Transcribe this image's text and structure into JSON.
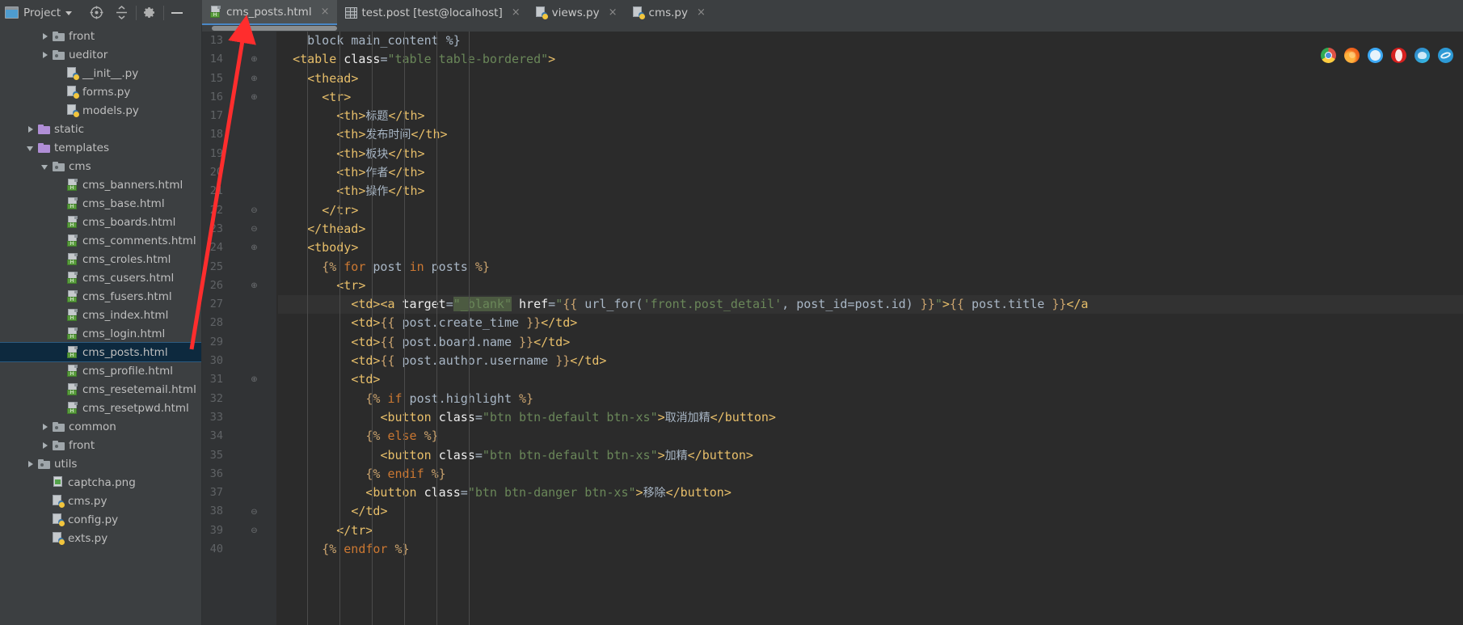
{
  "window": {
    "project_label": "Project",
    "toolbar_icons": [
      "target-icon",
      "collapse-all-icon",
      "settings-gear-icon",
      "minimize-icon"
    ]
  },
  "tabs": [
    {
      "label": "cms_posts.html",
      "icon": "html-file-icon",
      "active": true,
      "close": "×"
    },
    {
      "label": "test.post [test@localhost]",
      "icon": "database-table-icon",
      "active": false,
      "close": "×"
    },
    {
      "label": "views.py",
      "icon": "python-file-icon",
      "active": false,
      "close": "×"
    },
    {
      "label": "cms.py",
      "icon": "python-file-icon",
      "active": false,
      "close": "×"
    }
  ],
  "tree": [
    {
      "label": "front",
      "indent": 2,
      "arrow": "right",
      "icon": "folder-grey",
      "selected": false
    },
    {
      "label": "ueditor",
      "indent": 2,
      "arrow": "right",
      "icon": "folder-grey",
      "selected": false
    },
    {
      "label": "__init__.py",
      "indent": 3,
      "arrow": "none",
      "icon": "python-file",
      "selected": false
    },
    {
      "label": "forms.py",
      "indent": 3,
      "arrow": "none",
      "icon": "python-file",
      "selected": false
    },
    {
      "label": "models.py",
      "indent": 3,
      "arrow": "none",
      "icon": "python-file",
      "selected": false
    },
    {
      "label": "static",
      "indent": 1,
      "arrow": "right",
      "icon": "folder-purple",
      "selected": false
    },
    {
      "label": "templates",
      "indent": 1,
      "arrow": "down",
      "icon": "folder-purple",
      "selected": false
    },
    {
      "label": "cms",
      "indent": 2,
      "arrow": "down",
      "icon": "folder-grey",
      "selected": false
    },
    {
      "label": "cms_banners.html",
      "indent": 3,
      "arrow": "none",
      "icon": "html-file",
      "selected": false
    },
    {
      "label": "cms_base.html",
      "indent": 3,
      "arrow": "none",
      "icon": "html-file",
      "selected": false
    },
    {
      "label": "cms_boards.html",
      "indent": 3,
      "arrow": "none",
      "icon": "html-file",
      "selected": false
    },
    {
      "label": "cms_comments.html",
      "indent": 3,
      "arrow": "none",
      "icon": "html-file",
      "selected": false
    },
    {
      "label": "cms_croles.html",
      "indent": 3,
      "arrow": "none",
      "icon": "html-file",
      "selected": false
    },
    {
      "label": "cms_cusers.html",
      "indent": 3,
      "arrow": "none",
      "icon": "html-file",
      "selected": false
    },
    {
      "label": "cms_fusers.html",
      "indent": 3,
      "arrow": "none",
      "icon": "html-file",
      "selected": false
    },
    {
      "label": "cms_index.html",
      "indent": 3,
      "arrow": "none",
      "icon": "html-file",
      "selected": false
    },
    {
      "label": "cms_login.html",
      "indent": 3,
      "arrow": "none",
      "icon": "html-file",
      "selected": false
    },
    {
      "label": "cms_posts.html",
      "indent": 3,
      "arrow": "none",
      "icon": "html-file",
      "selected": true
    },
    {
      "label": "cms_profile.html",
      "indent": 3,
      "arrow": "none",
      "icon": "html-file",
      "selected": false
    },
    {
      "label": "cms_resetemail.html",
      "indent": 3,
      "arrow": "none",
      "icon": "html-file",
      "selected": false
    },
    {
      "label": "cms_resetpwd.html",
      "indent": 3,
      "arrow": "none",
      "icon": "html-file",
      "selected": false
    },
    {
      "label": "common",
      "indent": 2,
      "arrow": "right",
      "icon": "folder-grey",
      "selected": false
    },
    {
      "label": "front",
      "indent": 2,
      "arrow": "right",
      "icon": "folder-grey",
      "selected": false
    },
    {
      "label": "utils",
      "indent": 1,
      "arrow": "right",
      "icon": "folder-grey",
      "selected": false
    },
    {
      "label": "captcha.png",
      "indent": 2,
      "arrow": "none",
      "icon": "png-file",
      "selected": false
    },
    {
      "label": "cms.py",
      "indent": 2,
      "arrow": "none",
      "icon": "python-file",
      "selected": false
    },
    {
      "label": "config.py",
      "indent": 2,
      "arrow": "none",
      "icon": "python-file",
      "selected": false
    },
    {
      "label": "exts.py",
      "indent": 2,
      "arrow": "none",
      "icon": "python-file",
      "selected": false
    }
  ],
  "editor": {
    "current_line": 27,
    "first_line_number": 13,
    "lines": [
      {
        "n": 13,
        "fold": "",
        "indent": 0,
        "text": "block main_content %}"
      },
      {
        "n": 14,
        "fold": "+",
        "indent": 0,
        "text": "<table class=\"table table-bordered\">"
      },
      {
        "n": 15,
        "fold": "+",
        "indent": 0,
        "text": "<thead>"
      },
      {
        "n": 16,
        "fold": "+",
        "indent": 0,
        "text": "<tr>"
      },
      {
        "n": 17,
        "fold": "",
        "indent": 0,
        "text": "<th>标题</th>"
      },
      {
        "n": 18,
        "fold": "",
        "indent": 0,
        "text": "<th>发布时间</th>"
      },
      {
        "n": 19,
        "fold": "",
        "indent": 0,
        "text": "<th>板块</th>"
      },
      {
        "n": 20,
        "fold": "",
        "indent": 0,
        "text": "<th>作者</th>"
      },
      {
        "n": 21,
        "fold": "",
        "indent": 0,
        "text": "<th>操作</th>"
      },
      {
        "n": 22,
        "fold": "-",
        "indent": 0,
        "text": "</tr>"
      },
      {
        "n": 23,
        "fold": "-",
        "indent": 0,
        "text": "</thead>"
      },
      {
        "n": 24,
        "fold": "+",
        "indent": 0,
        "text": "<tbody>"
      },
      {
        "n": 25,
        "fold": "",
        "indent": 0,
        "text": "{% for post in posts %}"
      },
      {
        "n": 26,
        "fold": "+",
        "indent": 0,
        "text": "<tr>"
      },
      {
        "n": 27,
        "fold": "",
        "indent": 0,
        "text": "<td><a target=\"_blank\" href=\"{{ url_for('front.post_detail', post_id=post.id) }}\">{{ post.title }}</a"
      },
      {
        "n": 28,
        "fold": "",
        "indent": 0,
        "text": "<td>{{ post.create_time }}</td>"
      },
      {
        "n": 29,
        "fold": "",
        "indent": 0,
        "text": "<td>{{ post.board.name }}</td>"
      },
      {
        "n": 30,
        "fold": "",
        "indent": 0,
        "text": "<td>{{ post.author.username }}</td>"
      },
      {
        "n": 31,
        "fold": "+",
        "indent": 0,
        "text": "<td>"
      },
      {
        "n": 32,
        "fold": "",
        "indent": 0,
        "text": "{% if post.highlight %}"
      },
      {
        "n": 33,
        "fold": "",
        "indent": 0,
        "text": "<button class=\"btn btn-default btn-xs\">取消加精</button>"
      },
      {
        "n": 34,
        "fold": "",
        "indent": 0,
        "text": "{% else %}"
      },
      {
        "n": 35,
        "fold": "",
        "indent": 0,
        "text": "<button class=\"btn btn-default btn-xs\">加精</button>"
      },
      {
        "n": 36,
        "fold": "",
        "indent": 0,
        "text": "{% endif %}"
      },
      {
        "n": 37,
        "fold": "",
        "indent": 0,
        "text": "<button class=\"btn btn-danger btn-xs\">移除</button>"
      },
      {
        "n": 38,
        "fold": "-",
        "indent": 0,
        "text": "</td>"
      },
      {
        "n": 39,
        "fold": "-",
        "indent": 0,
        "text": "</tr>"
      },
      {
        "n": 40,
        "fold": "",
        "indent": 0,
        "text": "{% endfor %}"
      }
    ],
    "selected_text": "_blank",
    "browser_icons": [
      "chrome-icon",
      "firefox-icon",
      "safari-icon",
      "opera-icon",
      "edge-icon",
      "ie-icon"
    ]
  },
  "annotation": {
    "type": "red-arrow",
    "points_from": "cms_posts.html tree item",
    "points_to": "cms_posts.html editor tab",
    "color": "#ff2d2d"
  },
  "colors": {
    "background": "#3c3f41",
    "editor_bg": "#2b2b2b",
    "selection": "#0d293e",
    "active_tab": "#4e5254",
    "tag": "#e8bf6a",
    "string": "#6a8759",
    "keyword": "#cc7832",
    "text": "#a9b7c6"
  }
}
